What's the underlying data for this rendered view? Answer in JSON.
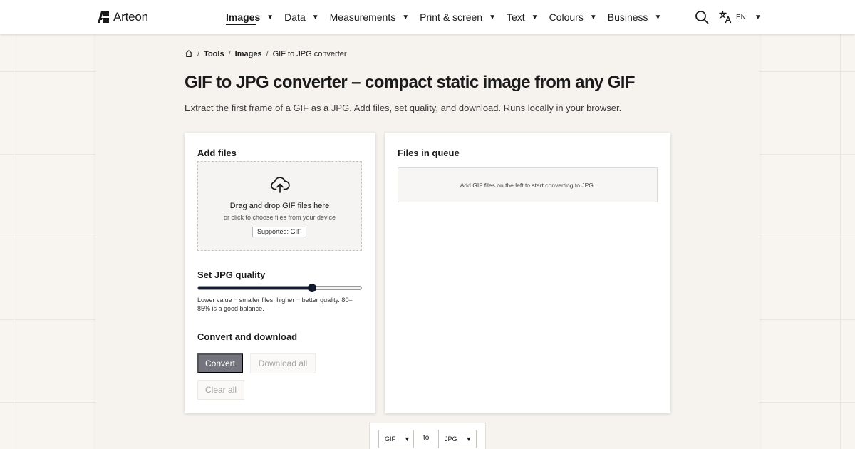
{
  "header": {
    "brand": "Arteon",
    "nav": [
      {
        "label": "Images",
        "active": true
      },
      {
        "label": "Data",
        "active": false
      },
      {
        "label": "Measurements",
        "active": false
      },
      {
        "label": "Print & screen",
        "active": false
      },
      {
        "label": "Text",
        "active": false
      },
      {
        "label": "Colours",
        "active": false
      },
      {
        "label": "Business",
        "active": false
      }
    ],
    "caret": "▼",
    "search_icon": "search-icon",
    "language": {
      "icon": "translate-icon",
      "code": "EN"
    }
  },
  "breadcrumb": {
    "home_icon": "home-icon",
    "separator": "/",
    "items": [
      "Tools",
      "Images",
      "GIF to JPG converter"
    ]
  },
  "page": {
    "title": "GIF to JPG converter – compact static image from any GIF",
    "subtitle": "Extract the first frame of a GIF as a JPG. Add files, set quality, and download. Runs locally in your browser."
  },
  "add_files": {
    "heading": "Add files",
    "drop_title": "Drag and drop GIF files here",
    "drop_subtitle": "or click to choose files from your device",
    "supported": "Supported: GIF",
    "upload_icon": "cloud-upload-icon"
  },
  "quality": {
    "heading": "Set JPG quality",
    "value_fraction": 0.7,
    "hint": "Lower value = smaller files, higher = better quality. 80–85% is a good balance."
  },
  "convert": {
    "heading": "Convert and download",
    "convert_label": "Convert",
    "download_label": "Download all",
    "clear_label": "Clear all"
  },
  "queue": {
    "heading": "Files in queue",
    "empty_message": "Add GIF files on the left to start converting to JPG."
  },
  "format_bar": {
    "from": "GIF",
    "connector": "to",
    "to": "JPG"
  },
  "colors": {
    "accent_dark": "#141a2e",
    "convert_button": "#74747f",
    "page_background": "#f8f4f0"
  }
}
